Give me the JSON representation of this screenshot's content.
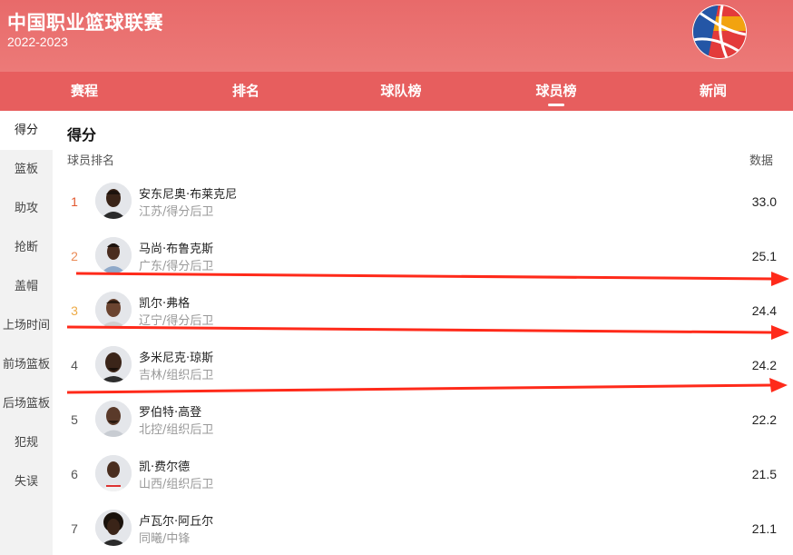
{
  "header": {
    "title": "中国职业篮球联赛",
    "season": "2022-2023"
  },
  "nav": {
    "tabs": [
      {
        "label": "赛程",
        "name": "tab-schedule",
        "active": false
      },
      {
        "label": "排名",
        "name": "tab-standings",
        "active": false
      },
      {
        "label": "球队榜",
        "name": "tab-team-stats",
        "active": false
      },
      {
        "label": "球员榜",
        "name": "tab-player-stats",
        "active": true
      },
      {
        "label": "新闻",
        "name": "tab-news",
        "active": false
      }
    ]
  },
  "sidebar": {
    "items": [
      {
        "label": "得分",
        "active": true
      },
      {
        "label": "篮板",
        "active": false
      },
      {
        "label": "助攻",
        "active": false
      },
      {
        "label": "抢断",
        "active": false
      },
      {
        "label": "盖帽",
        "active": false
      },
      {
        "label": "上场时间",
        "active": false
      },
      {
        "label": "前场篮板",
        "active": false
      },
      {
        "label": "后场篮板",
        "active": false
      },
      {
        "label": "犯规",
        "active": false
      },
      {
        "label": "失误",
        "active": false
      }
    ]
  },
  "main": {
    "section_title": "得分",
    "col_left": "球员排名",
    "col_right": "数据",
    "rows": [
      {
        "rank": "1",
        "name": "安东尼奥·布莱克尼",
        "team": "江苏/得分后卫",
        "value": "33.0"
      },
      {
        "rank": "2",
        "name": "马尚·布鲁克斯",
        "team": "广东/得分后卫",
        "value": "25.1"
      },
      {
        "rank": "3",
        "name": "凯尔·弗格",
        "team": "辽宁/得分后卫",
        "value": "24.4"
      },
      {
        "rank": "4",
        "name": "多米尼克·琼斯",
        "team": "吉林/组织后卫",
        "value": "24.2"
      },
      {
        "rank": "5",
        "name": "罗伯特·高登",
        "team": "北控/组织后卫",
        "value": "22.2"
      },
      {
        "rank": "6",
        "name": "凯·费尔德",
        "team": "山西/组织后卫",
        "value": "21.5"
      },
      {
        "rank": "7",
        "name": "卢瓦尔·阿丘尔",
        "team": "同曦/中锋",
        "value": "21.1"
      }
    ]
  },
  "colors": {
    "header": "#e86a6a",
    "nav": "#e75e5e",
    "rank_1": "#e2572e",
    "rank_2": "#ea8b57",
    "rank_3": "#edaa46",
    "annotation_arrow": "#ff2a1a"
  }
}
